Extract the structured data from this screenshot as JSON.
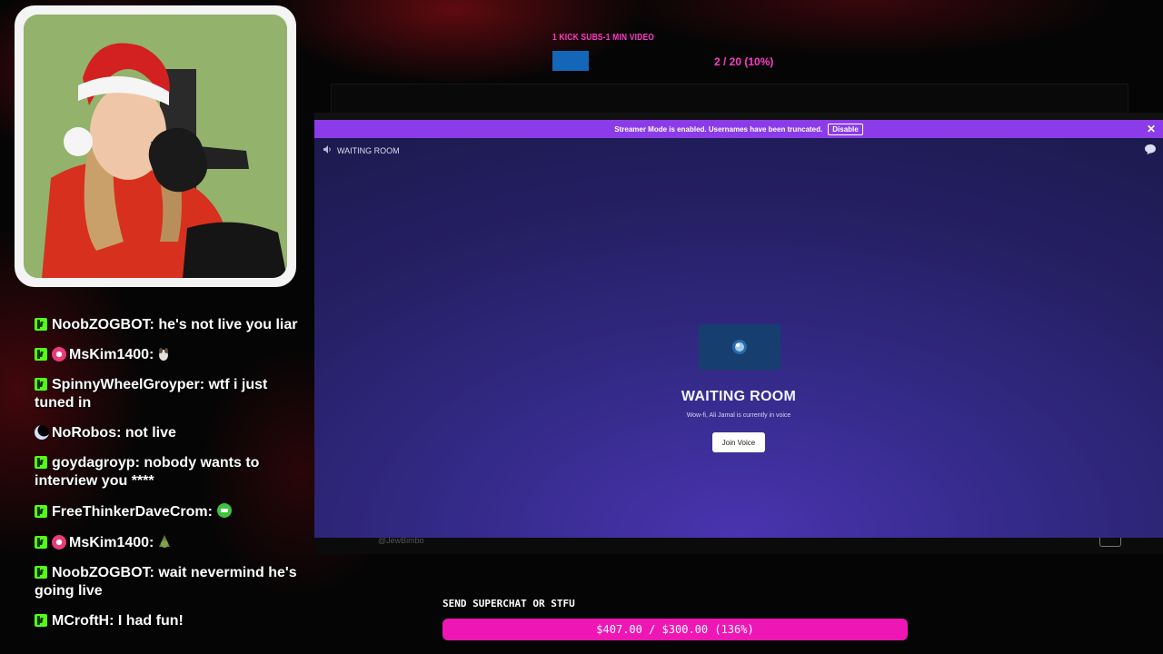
{
  "goal": {
    "title": "1 KICK SUBS-1 MIN VIDEO",
    "progress_text": "2 / 20 (10%)",
    "progress_fraction": 0.1
  },
  "browser": {
    "banner_text": "Streamer Mode is enabled. Usernames have been truncated.",
    "banner_button": "Disable",
    "close_glyph": "✕",
    "room_header": "WAITING ROOM",
    "room_title": "WAITING ROOM",
    "room_subtitle": "Wow-fi, Ali Jamal is currently in voice",
    "join_button": "Join Voice",
    "bottom_handle": "@JewBimbo"
  },
  "chat": {
    "messages": [
      {
        "text": "NoobZOGBOT: he's not live you liar",
        "badges": [
          "kick"
        ]
      },
      {
        "text": "MsKim1400:",
        "badges": [
          "kick",
          "pink-badge"
        ],
        "emote": "dog-emote"
      },
      {
        "text": "SpinnyWheelGroyper: wtf i just tuned in",
        "badges": [
          "kick"
        ]
      },
      {
        "text": "NoRobos: not live",
        "badges": [
          "moon-badge"
        ]
      },
      {
        "text": "goydagroyp: nobody wants to interview you ****",
        "badges": [
          "kick"
        ]
      },
      {
        "text": "FreeThinkerDaveCrom:",
        "badges": [
          "kick"
        ],
        "emote": "green-emote"
      },
      {
        "text": "MsKim1400:",
        "badges": [
          "kick",
          "pink-badge"
        ],
        "emote": "pepe-emote"
      },
      {
        "text": "NoobZOGBOT: wait nevermind he's going live",
        "badges": [
          "kick"
        ]
      },
      {
        "text": "MCroftH: I had fun!",
        "badges": [
          "kick"
        ]
      }
    ]
  },
  "superchat": {
    "label": "SEND SUPERCHAT OR STFU",
    "progress_text": "$407.00 / $300.00 (136%)",
    "progress_fraction": 1.36
  },
  "colors": {
    "accent_pink": "#ee16b5",
    "banner_purple": "#8b3ce8",
    "kick_green": "#53fc18"
  }
}
